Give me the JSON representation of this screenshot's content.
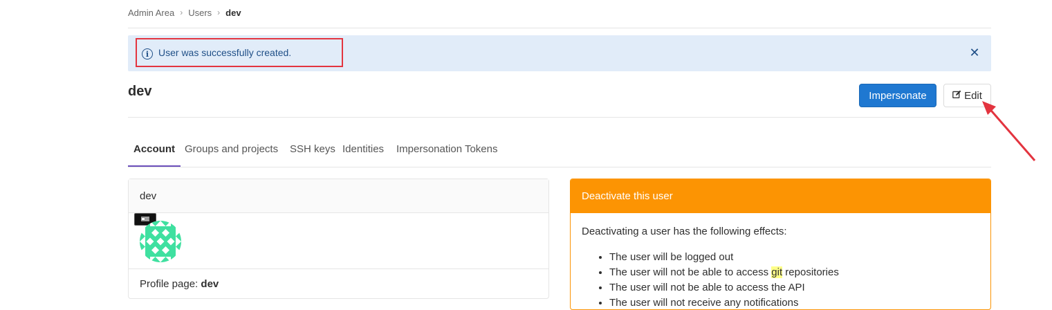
{
  "breadcrumb": {
    "items": [
      "Admin Area",
      "Users"
    ],
    "current": "dev",
    "separator": "›"
  },
  "flash": {
    "icon": "info-circle-icon",
    "message": "User was successfully created.",
    "close_symbol": "✕",
    "background": "#e1ecf9",
    "text_color": "#1f4f87"
  },
  "header": {
    "title": "dev",
    "impersonate_label": "Impersonate",
    "edit_label": "Edit",
    "edit_icon": "pencil-square-icon",
    "primary_color": "#1f78d1"
  },
  "tabs": [
    {
      "label": "Account",
      "active": true
    },
    {
      "label": "Groups and projects",
      "active": false
    },
    {
      "label": "SSH keys",
      "active": false
    },
    {
      "label": "Identities",
      "active": false
    },
    {
      "label": "Impersonation Tokens",
      "active": false
    }
  ],
  "account_card": {
    "header": "dev",
    "avatar_icon": "identicon-avatar",
    "profile_label": "Profile page:",
    "profile_value": "dev"
  },
  "deactivate_card": {
    "header": "Deactivate this user",
    "header_color": "#fc9403",
    "intro": "Deactivating a user has the following effects:",
    "effects": [
      {
        "before": "The user will be logged out",
        "highlight": "",
        "after": ""
      },
      {
        "before": "The user will not be able to access ",
        "highlight": "git",
        "after": " repositories"
      },
      {
        "before": "The user will not be able to access the API",
        "highlight": "",
        "after": ""
      },
      {
        "before": "The user will not receive any notifications",
        "highlight": "",
        "after": ""
      }
    ]
  },
  "annotation": {
    "highlight_color": "#e3343f"
  }
}
